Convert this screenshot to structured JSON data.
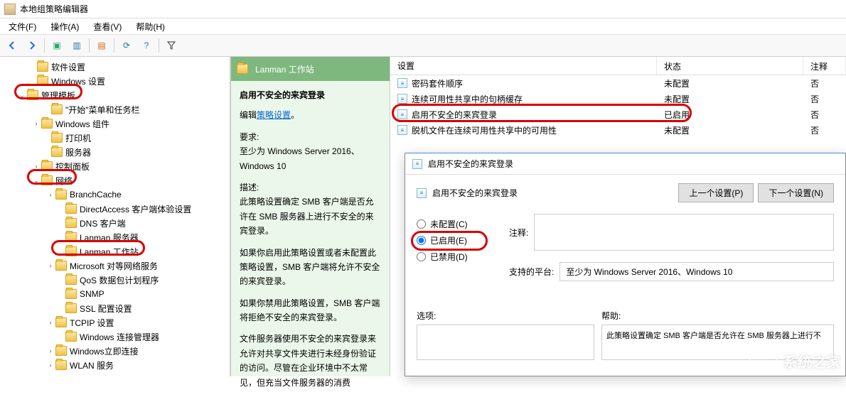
{
  "window": {
    "title": "本地组策略编辑器"
  },
  "menu": {
    "file": "文件(F)",
    "action": "操作(A)",
    "view": "查看(V)",
    "help": "帮助(H)"
  },
  "tree": {
    "soft": "软件设置",
    "win": "Windows 设置",
    "admin": "管理模板",
    "start": "\"开始\"菜单和任务栏",
    "wincomp": "Windows 组件",
    "printer": "打印机",
    "server": "服务器",
    "ctrl": "控制面板",
    "network": "网络",
    "branch": "BranchCache",
    "direct": "DirectAccess 客户端体验设置",
    "dns": "DNS 客户端",
    "lanserv": "Lanman 服务器",
    "lanws": "Lanman 工作站",
    "ms": "Microsoft 对等网络服务",
    "qos": "QoS 数据包计划程序",
    "snmp": "SNMP",
    "ssl": "SSL 配置设置",
    "tcpip": "TCPIP 设置",
    "winconn": "Windows 连接管理器",
    "wininst": "Windows立即连接",
    "wlan": "WLAN 服务"
  },
  "desc": {
    "header": "Lanman 工作站",
    "title": "启用不安全的来宾登录",
    "edit_prefix": "编辑",
    "edit_link": "策略设置",
    "req_label": "要求:",
    "req_text": "至少为 Windows Server 2016、Windows 10",
    "body_label": "描述:",
    "p1": "此策略设置确定 SMB 客户端是否允许在 SMB 服务器上进行不安全的来宾登录。",
    "p2": "如果你启用此策略设置或者未配置此策略设置，SMB 客户端将允许不安全的来宾登录。",
    "p3": "如果你禁用此策略设置，SMB 客户端将拒绝不安全的来宾登录。",
    "p4": "文件服务器使用不安全的来宾登录来允许对共享文件夹进行未经身份验证的访问。尽管在企业环境中不太常见，但充当文件服务器的消费"
  },
  "cols": {
    "setting": "设置",
    "status": "状态",
    "note": "注释"
  },
  "rows": [
    {
      "s": "密码套件顺序",
      "st": "未配置",
      "n": "否"
    },
    {
      "s": "连续可用性共享中的句柄缓存",
      "st": "未配置",
      "n": "否"
    },
    {
      "s": "启用不安全的来宾登录",
      "st": "已启用",
      "n": "否"
    },
    {
      "s": "脱机文件在连续可用性共享中的可用性",
      "st": "未配置",
      "n": "否"
    }
  ],
  "dialog": {
    "title": "启用不安全的来宾登录",
    "subtitle": "启用不安全的来宾登录",
    "prev": "上一个设置(P)",
    "next": "下一个设置(N)",
    "r_notconf": "未配置(C)",
    "r_enabled": "已启用(E)",
    "r_disabled": "已禁用(D)",
    "note_label": "注释:",
    "platform_label": "支持的平台:",
    "platform_text": "至少为 Windows Server 2016、Windows 10",
    "opt_label": "选项:",
    "help_label": "帮助:",
    "help_text": "此策略设置确定 SMB 客户端是否允许在 SMB 服务器上进行不"
  },
  "watermark": "系统之家"
}
